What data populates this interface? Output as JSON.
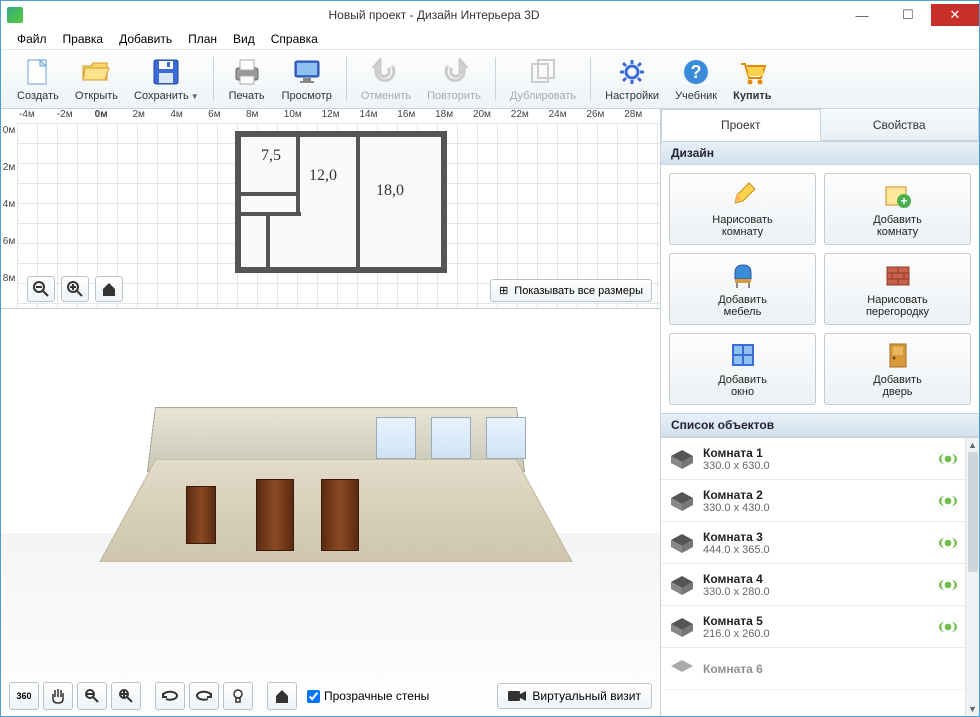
{
  "window": {
    "title": "Новый проект - Дизайн Интерьера 3D"
  },
  "menu": [
    "Файл",
    "Правка",
    "Добавить",
    "План",
    "Вид",
    "Справка"
  ],
  "toolbar": [
    {
      "id": "create",
      "label": "Создать",
      "group": 0
    },
    {
      "id": "open",
      "label": "Открыть",
      "group": 0
    },
    {
      "id": "save",
      "label": "Сохранить",
      "group": 0,
      "dropdown": true
    },
    {
      "id": "print",
      "label": "Печать",
      "group": 1
    },
    {
      "id": "preview",
      "label": "Просмотр",
      "group": 1
    },
    {
      "id": "undo",
      "label": "Отменить",
      "group": 2,
      "disabled": true
    },
    {
      "id": "redo",
      "label": "Повторить",
      "group": 2,
      "disabled": true
    },
    {
      "id": "duplicate",
      "label": "Дублировать",
      "group": 3,
      "disabled": true
    },
    {
      "id": "settings",
      "label": "Настройки",
      "group": 4
    },
    {
      "id": "help",
      "label": "Учебник",
      "group": 4
    },
    {
      "id": "buy",
      "label": "Купить",
      "group": 4,
      "bold": true
    }
  ],
  "ruler": {
    "h": [
      "-4м",
      "-2м",
      "0м",
      "2м",
      "4м",
      "6м",
      "8м",
      "10м",
      "12м",
      "14м",
      "16м",
      "18м",
      "20м",
      "22м",
      "24м",
      "26м",
      "28м"
    ],
    "v": [
      "0м",
      "2м",
      "4м",
      "6м",
      "8м"
    ]
  },
  "rooms2d": [
    {
      "label": "7,5"
    },
    {
      "label": "12,0"
    },
    {
      "label": "18,0"
    }
  ],
  "show_sizes_label": "Показывать все размеры",
  "view3d_toolbar": {
    "transparent_walls": "Прозрачные стены",
    "virtual_visit": "Виртуальный визит",
    "rotate_label": "360"
  },
  "tabs": {
    "project": "Проект",
    "properties": "Свойства"
  },
  "sections": {
    "design": "Дизайн",
    "objects": "Список объектов"
  },
  "design_buttons": [
    {
      "id": "draw-room",
      "l1": "Нарисовать",
      "l2": "комнату"
    },
    {
      "id": "add-room",
      "l1": "Добавить",
      "l2": "комнату"
    },
    {
      "id": "add-furniture",
      "l1": "Добавить",
      "l2": "мебель"
    },
    {
      "id": "draw-partition",
      "l1": "Нарисовать",
      "l2": "перегородку"
    },
    {
      "id": "add-window",
      "l1": "Добавить",
      "l2": "окно"
    },
    {
      "id": "add-door",
      "l1": "Добавить",
      "l2": "дверь"
    }
  ],
  "objects": [
    {
      "name": "Комната 1",
      "size": "330.0 x 630.0"
    },
    {
      "name": "Комната 2",
      "size": "330.0 x 430.0"
    },
    {
      "name": "Комната 3",
      "size": "444.0 x 365.0"
    },
    {
      "name": "Комната 4",
      "size": "330.0 x 280.0"
    },
    {
      "name": "Комната 5",
      "size": "216.0 x 260.0"
    },
    {
      "name": "Комната 6",
      "size": ""
    }
  ]
}
